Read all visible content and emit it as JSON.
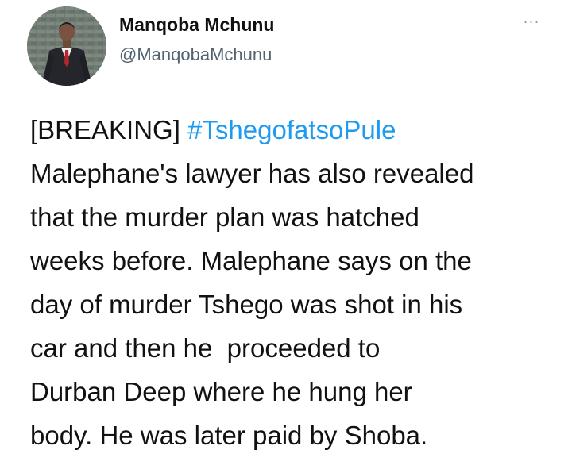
{
  "author": {
    "name": "Manqoba Mchunu",
    "handle": "@ManqobaMchunu"
  },
  "more_menu": {
    "glyph": "···"
  },
  "tweet": {
    "tag_prefix": "[BREAKING] ",
    "hashtag": "#TshegofatsoPule",
    "lines": [
      "Malephane's lawyer has also revealed",
      "that the murder plan was hatched",
      "weeks before. Malephane says on the",
      "day of murder Tshego was shot in his",
      "car and then he  proceeded to",
      "Durban Deep where he hung her",
      "body. He was later paid by Shoba."
    ]
  },
  "colors": {
    "link": "#1d9bf0",
    "handle": "#536471",
    "text": "#111111"
  }
}
